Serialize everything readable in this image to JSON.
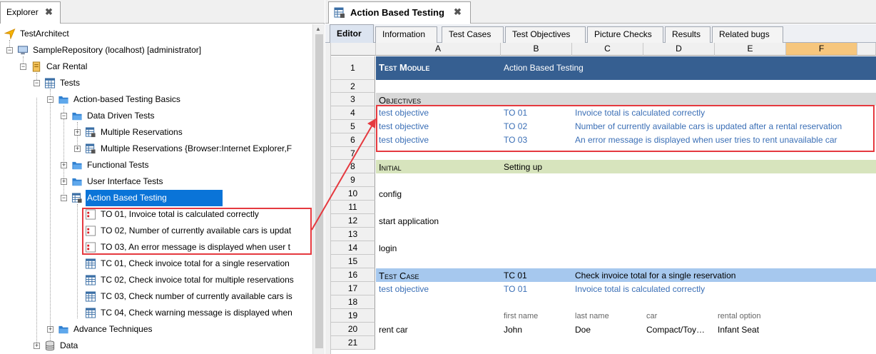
{
  "explorer": {
    "tab_label": "Explorer",
    "close_glyph": "✖",
    "tree": [
      {
        "label": "TestArchitect",
        "icon": "arrow-logo-icon"
      },
      {
        "label": "SampleRepository (localhost) [administrator]",
        "icon": "computer-icon"
      },
      {
        "label": "Car Rental",
        "icon": "project-icon"
      },
      {
        "label": "Tests",
        "icon": "test-grid-icon"
      },
      {
        "label": "Action-based Testing Basics",
        "icon": "folder-icon"
      },
      {
        "label": "Data Driven Tests",
        "icon": "folder-icon"
      },
      {
        "label": "Multiple Reservations",
        "icon": "locked-module-icon"
      },
      {
        "label": "Multiple Reservations {Browser:Internet Explorer,F",
        "icon": "locked-module-icon"
      },
      {
        "label": "Functional Tests",
        "icon": "folder-icon"
      },
      {
        "label": "User Interface Tests",
        "icon": "folder-icon"
      },
      {
        "label": "Action Based Testing",
        "icon": "locked-module-icon"
      },
      {
        "label": "TO 01, Invoice total is calculated correctly",
        "icon": "objective-icon"
      },
      {
        "label": "TO 02, Number of currently available cars is updat",
        "icon": "objective-icon"
      },
      {
        "label": "TO 03, An error message is displayed when user t",
        "icon": "objective-icon"
      },
      {
        "label": "TC 01, Check invoice total for a single reservation",
        "icon": "test-case-icon"
      },
      {
        "label": "TC 02, Check invoice total for multiple reservations",
        "icon": "test-case-icon"
      },
      {
        "label": "TC 03, Check number of currently available cars is",
        "icon": "test-case-icon"
      },
      {
        "label": "TC 04, Check warning message is displayed when",
        "icon": "test-case-icon"
      },
      {
        "label": "Advance Techniques",
        "icon": "folder-icon"
      },
      {
        "label": "Data",
        "icon": "database-icon"
      }
    ]
  },
  "editor": {
    "tab_label": "Action Based Testing",
    "close_glyph": "✖",
    "subtabs": [
      "Editor",
      "Information",
      "Test Cases",
      "Test Objectives",
      "Picture Checks",
      "Results",
      "Related bugs"
    ],
    "columns": [
      "A",
      "B",
      "C",
      "D",
      "E",
      "F"
    ],
    "rows": {
      "r1": {
        "num": "1",
        "a": "Test Module",
        "b": "Action Based Testing"
      },
      "r2": {
        "num": "2"
      },
      "r3": {
        "num": "3",
        "a": "Objectives"
      },
      "r4": {
        "num": "4",
        "a": "test objective",
        "b": "TO 01",
        "c": "Invoice total is calculated correctly"
      },
      "r5": {
        "num": "5",
        "a": "test objective",
        "b": "TO 02",
        "c": "Number of currently available cars is updated after a rental reservation"
      },
      "r6": {
        "num": "6",
        "a": "test objective",
        "b": "TO 03",
        "c": "An error message is displayed when user tries to rent unavailable car"
      },
      "r7": {
        "num": "7"
      },
      "r8": {
        "num": "8",
        "a": "Initial",
        "b": "Setting up"
      },
      "r9": {
        "num": "9"
      },
      "r10": {
        "num": "10",
        "a": "config"
      },
      "r11": {
        "num": "11"
      },
      "r12": {
        "num": "12",
        "a": "start application"
      },
      "r13": {
        "num": "13"
      },
      "r14": {
        "num": "14",
        "a": "login"
      },
      "r15": {
        "num": "15"
      },
      "r16": {
        "num": "16",
        "a": "Test Case",
        "b": "TC 01",
        "c": "Check invoice total for a single reservation"
      },
      "r17": {
        "num": "17",
        "a": "test objective",
        "b": "TO 01",
        "c": "Invoice total is calculated correctly"
      },
      "r18": {
        "num": "18"
      },
      "r19": {
        "num": "19",
        "b": "first name",
        "c": "last name",
        "d": "car",
        "e": "rental option"
      },
      "r20": {
        "num": "20",
        "a": "rent car",
        "b": "John",
        "c": "Doe",
        "d": "Compact/Toy…",
        "e": "Infant Seat"
      },
      "r21": {
        "num": "21"
      }
    }
  },
  "colors": {
    "module_header": "#365f91",
    "objectives_header": "#d9d9d9",
    "initial_header": "#d7e4bd",
    "test_case_header": "#a6c8ee",
    "highlight_box": "#e5393f",
    "selection": "#0a74d8"
  }
}
